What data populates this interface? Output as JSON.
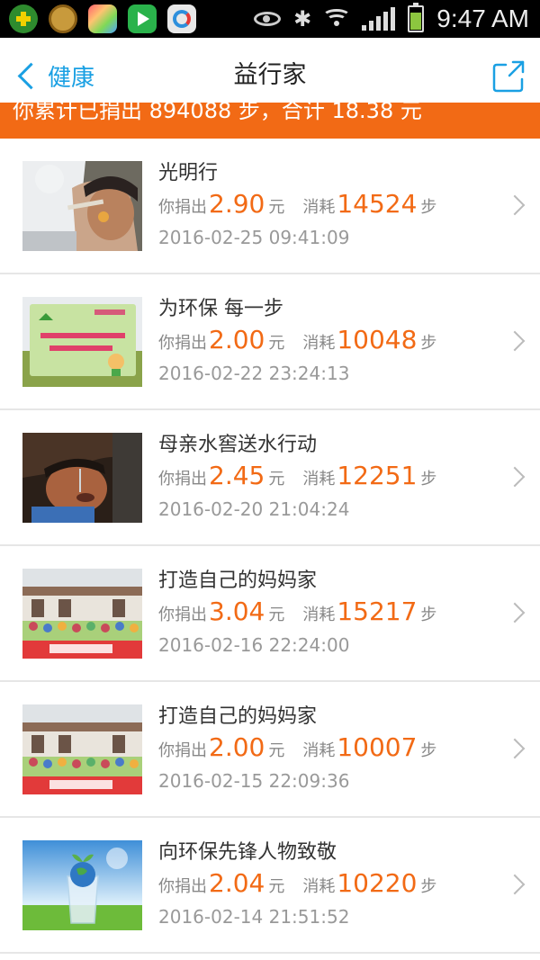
{
  "status_bar": {
    "time": "9:47 AM",
    "icons": [
      "app-plus-icon",
      "smiley-icon",
      "pinwheel-icon",
      "video-play-icon",
      "browser-icon",
      "eye-icon",
      "bluetooth-icon",
      "wifi-icon",
      "signal-icon",
      "battery-icon"
    ]
  },
  "header": {
    "back_label": "健康",
    "title": "益行家",
    "share_icon": "share-icon"
  },
  "banner": {
    "text": "你累计已捐出 894088 步，合计 18.38 元"
  },
  "labels": {
    "donated_prefix": "你捐出",
    "yuan": "元",
    "consumed_prefix": "消耗",
    "steps_unit": "步"
  },
  "colors": {
    "accent_orange": "#f26a15",
    "link_blue": "#1aa0e3"
  },
  "items": [
    {
      "name": "光明行",
      "amount": "2.90",
      "steps": "14524",
      "date": "2016-02-25 09:41:09",
      "thumb": "eye-exam-photo"
    },
    {
      "name": "为环保 每一步",
      "amount": "2.00",
      "steps": "10048",
      "date": "2016-02-22 23:24:13",
      "thumb": "eco-sign-photo"
    },
    {
      "name": "母亲水窖送水行动",
      "amount": "2.45",
      "steps": "12251",
      "date": "2016-02-20 21:04:24",
      "thumb": "child-drinking-photo"
    },
    {
      "name": "打造自己的妈妈家",
      "amount": "3.04",
      "steps": "15217",
      "date": "2016-02-16 22:24:00",
      "thumb": "group-photo"
    },
    {
      "name": "打造自己的妈妈家",
      "amount": "2.00",
      "steps": "10007",
      "date": "2016-02-15 22:09:36",
      "thumb": "group-photo"
    },
    {
      "name": "向环保先锋人物致敬",
      "amount": "2.04",
      "steps": "10220",
      "date": "2016-02-14 21:51:52",
      "thumb": "globe-glass-photo"
    }
  ]
}
